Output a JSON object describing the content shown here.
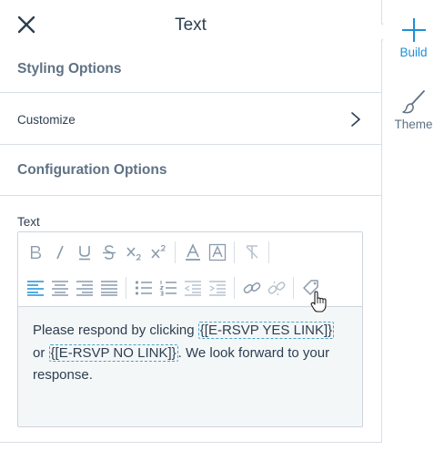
{
  "panel": {
    "title": "Text",
    "styling_section": "Styling Options",
    "customize_label": "Customize",
    "config_section": "Configuration Options",
    "field_label": "Text"
  },
  "editor": {
    "toolbar_row1": [
      "bold-icon",
      "italic-icon",
      "underline-icon",
      "strikethrough-icon",
      "subscript-icon",
      "superscript-icon",
      "font-color-icon",
      "highlight-color-icon",
      "clear-format-icon"
    ],
    "toolbar_row2": [
      "align-left-icon",
      "align-center-icon",
      "align-right-icon",
      "align-justify-icon",
      "bullet-list-icon",
      "numbered-list-icon",
      "outdent-icon",
      "indent-icon",
      "link-icon",
      "unlink-icon",
      "tag-icon"
    ],
    "content": {
      "part1": "Please respond by clicking ",
      "token_yes": "{[E-RSVP YES LINK]}",
      "part2": " or ",
      "token_no": "{[E-RSVP NO LINK]}",
      "part3": ". We look forward to your response."
    }
  },
  "rail": {
    "build_label": "Build",
    "theme_label": "Theme"
  },
  "colors": {
    "accent": "#1e90d6",
    "section_text": "#5f7184",
    "token_border": "#4aa3c5"
  }
}
